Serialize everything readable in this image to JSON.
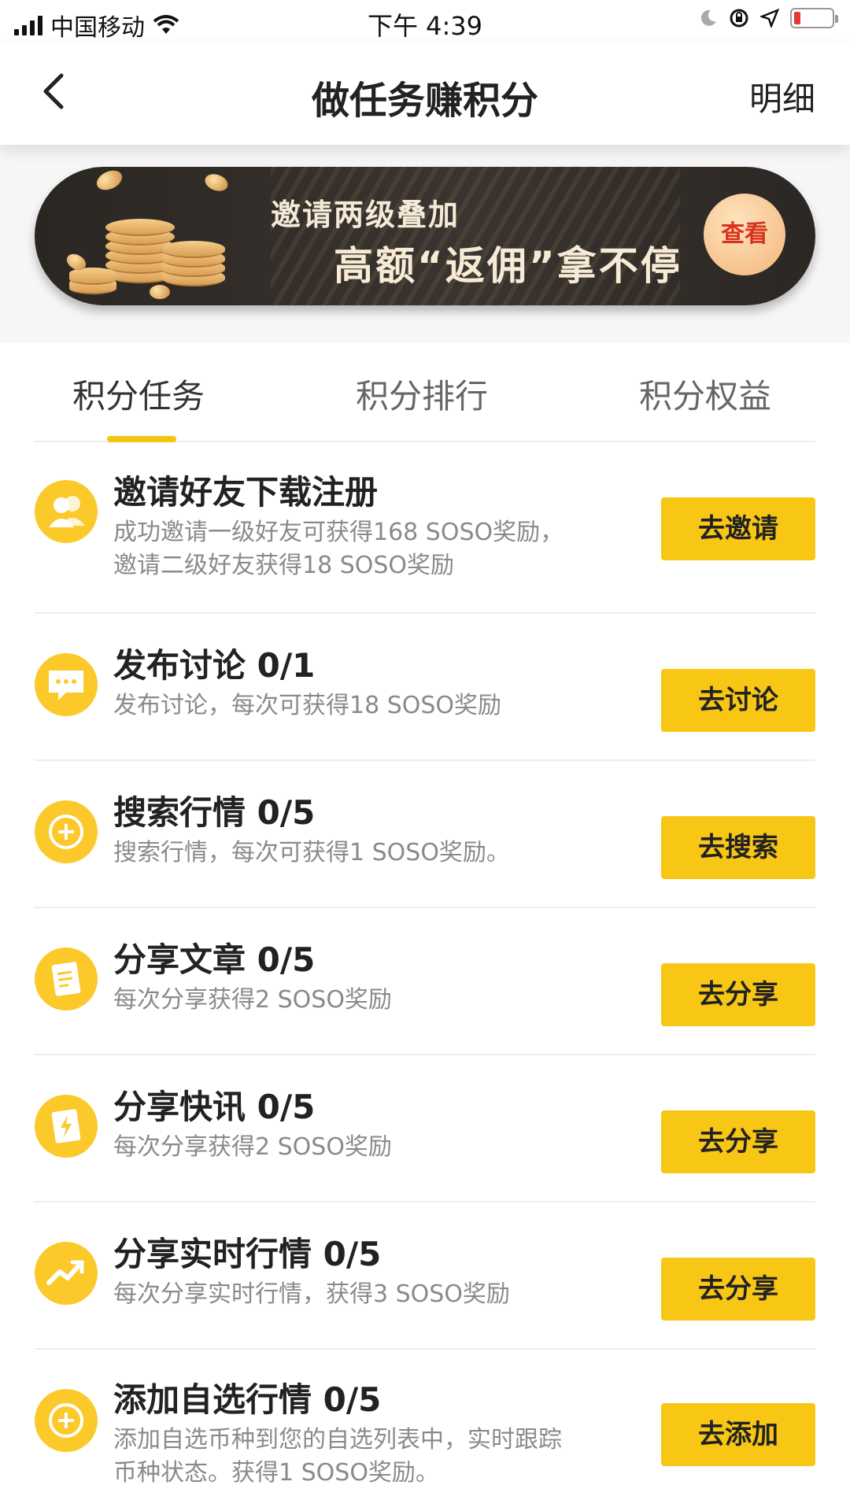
{
  "status_bar": {
    "carrier": "中国移动",
    "time": "下午 4:39"
  },
  "nav": {
    "title": "做任务赚积分",
    "detail_label": "明细"
  },
  "banner": {
    "line1": "邀请两级叠加",
    "line2": "高额“返佣”拿不停",
    "button_label": "查看"
  },
  "tabs": [
    {
      "label": "积分任务",
      "active": true
    },
    {
      "label": "积分排行",
      "active": false
    },
    {
      "label": "积分权益",
      "active": false
    }
  ],
  "tasks": [
    {
      "title": "邀请好友下载注册",
      "desc": "成功邀请一级好友可获得168 SOSO奖励，邀请二级好友获得18 SOSO奖励",
      "button": "去邀请",
      "icon": "friends-icon"
    },
    {
      "title": "发布讨论 0/1",
      "desc": "发布讨论，每次可获得18 SOSO奖励",
      "button": "去讨论",
      "icon": "chat-icon"
    },
    {
      "title": "搜索行情 0/5",
      "desc": "搜索行情，每次可获得1 SOSO奖励。",
      "button": "去搜索",
      "icon": "plus-circle-icon"
    },
    {
      "title": "分享文章 0/5",
      "desc": "每次分享获得2 SOSO奖励",
      "button": "去分享",
      "icon": "article-icon"
    },
    {
      "title": "分享快讯 0/5",
      "desc": "每次分享获得2 SOSO奖励",
      "button": "去分享",
      "icon": "flash-news-icon"
    },
    {
      "title": "分享实时行情 0/5",
      "desc": "每次分享实时行情，获得3 SOSO奖励",
      "button": "去分享",
      "icon": "trend-icon"
    },
    {
      "title": "添加自选行情 0/5",
      "desc": "添加自选币种到您的自选列表中，实时跟踪币种状态。获得1 SOSO奖励。",
      "button": "去添加",
      "icon": "plus-circle-icon"
    }
  ],
  "colors": {
    "accent": "#f8c614",
    "icon_bg": "#fbc92a",
    "tab_underline": "#f5c40f"
  }
}
